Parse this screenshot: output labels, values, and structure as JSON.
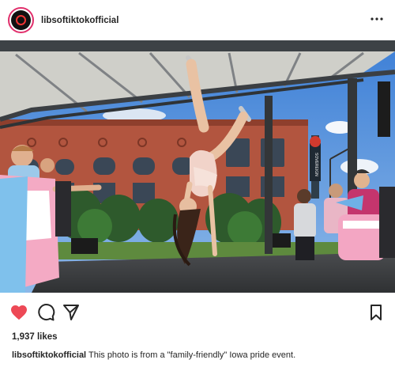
{
  "post": {
    "username": "libsoftiktokofficial",
    "more_icon": "more-horizontal-icon",
    "likes_text": "1,937 likes",
    "caption_user": "libsoftiktokofficial",
    "caption_text": " This photo is from a \"family-friendly\" Iowa pride event.",
    "liked": true
  },
  "actions": {
    "like_icon": "heart-icon",
    "comment_icon": "comment-icon",
    "share_icon": "send-icon",
    "save_icon": "bookmark-icon"
  },
  "photo": {
    "sign_text": "SOVEREIGN"
  },
  "colors": {
    "heart": "#ed4956",
    "text": "#262626",
    "avatar_ring": "#e1306c"
  }
}
